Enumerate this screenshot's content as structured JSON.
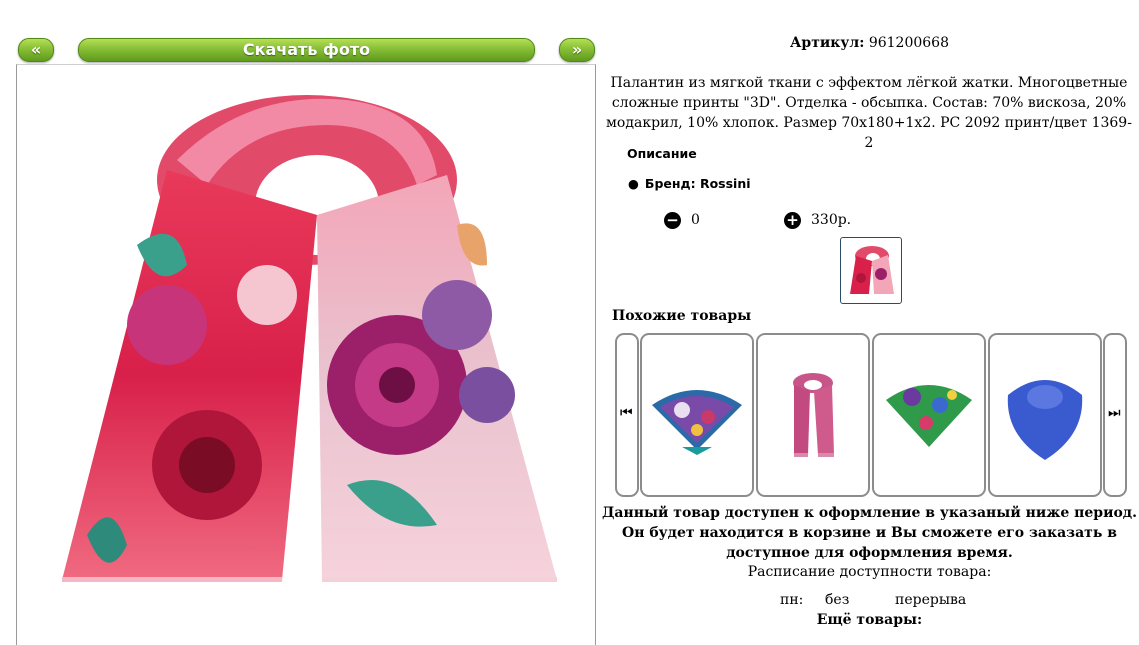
{
  "nav": {
    "prev_label": "«",
    "download_label": "Скачать фото",
    "next_label": "»"
  },
  "product": {
    "sku_label": "Артикул:",
    "sku_value": "961200668",
    "description": "Палантин из мягкой ткани с эффектом лёгкой жатки. Многоцветные сложные принты \"3D\". Отделка - обсыпка. Состав: 70% вискоза, 20% модакрил, 10% хлопок. Размер 70x180+1x2. PC 2092 принт/цвет 1369-2",
    "section_title": "Описание",
    "brand": "Бренд: Rossini",
    "quantity": "0",
    "price": "330р."
  },
  "icons": {
    "minus": "minus-circle-icon",
    "plus": "plus-circle-icon",
    "carousel_prev": "skip-back-icon",
    "carousel_next": "skip-forward-icon"
  },
  "similar": {
    "title": "Похожие товары",
    "prev_glyph": "⏮",
    "next_glyph": "⏭"
  },
  "availability": {
    "notice": "Данный товар доступен к оформление в указаный ниже период. Он будет находится в корзине и Вы сможете его заказать в доступное для оформления время.",
    "schedule_title": "Расписание доступности товара:",
    "day": "пн:",
    "from": "без",
    "to": "перерыва"
  },
  "more": {
    "title": "Ещё товары:"
  },
  "colors": {
    "accent_green": "#8cc23a",
    "border_gray": "#8c8c8c"
  }
}
